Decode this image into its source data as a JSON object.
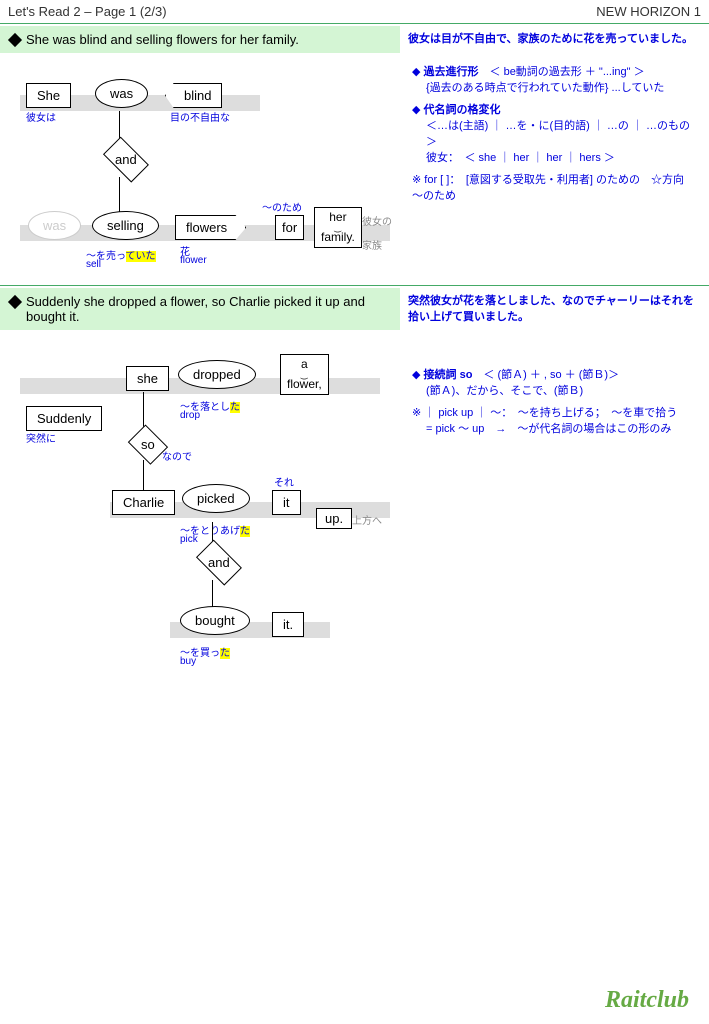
{
  "header": {
    "left": "Let's Read 2 – Page 1 (2/3)",
    "right": "NEW HORIZON 1"
  },
  "sec1": {
    "en": "She was blind and selling flowers for her family.",
    "jp": "彼女は目が不自由で、家族のために花を売っていました。",
    "w": {
      "she": "She",
      "was": "was",
      "blind": "blind",
      "and": "and",
      "was2": "was",
      "selling": "selling",
      "flowers": "flowers",
      "for": "for",
      "her": "her",
      "family": "family."
    },
    "a": {
      "she": "彼女は",
      "blind": "目の不自由な",
      "selling1": "～を売っ",
      "selling2": "ていた",
      "sell": "sell",
      "flowers": "花",
      "flower": "flower",
      "for_top": "～のため",
      "her": "彼女の",
      "family": "家族"
    },
    "notes": {
      "n1t": "過去進行形",
      "n1b": "＜ be動詞の過去形 ＋ \"...ing\" ＞",
      "n1s": "{過去のある時点で行われていた動作} ...していた",
      "n2t": "代名詞の格変化",
      "n2b": "＜…は(主語) ｜ …を・に(目的語) ｜ …の ｜ …のもの＞",
      "n2s": "彼女：　＜ she ｜ her ｜ her ｜ hers ＞",
      "n3": "※ for [  ]：　[意図する受取先・利用者] のための　☆方向 ～のため"
    }
  },
  "sec2": {
    "en": "Suddenly she dropped a flower, so Charlie picked it up and bought it.",
    "jp": "突然彼女が花を落としました、なのでチャーリーはそれを拾い上げて買いました。",
    "w": {
      "suddenly": "Suddenly",
      "she": "she",
      "dropped": "dropped",
      "a": "a",
      "flower": "flower,",
      "so": "so",
      "charlie": "Charlie",
      "picked": "picked",
      "it1": "it",
      "up": "up.",
      "and": "and",
      "bought": "bought",
      "it2": "it."
    },
    "a": {
      "suddenly": "突然に",
      "dropped1": "～を落とし",
      "dropped2": "た",
      "drop": "drop",
      "so": "なので",
      "picked1": "～をとりあげ",
      "picked2": "た",
      "pick": "pick",
      "it1": "それ",
      "up": "上方へ",
      "bought1": "～を買っ",
      "bought2": "た",
      "buy": "buy"
    },
    "notes": {
      "n1t": "接続詞 so",
      "n1b": "＜ (節Ａ) ＋ , so ＋ (節Ｂ)＞",
      "n1s": "(節Ａ)、だから、そこで、(節Ｂ)",
      "n2": "※ ｜ pick up ｜ ～：　～を持ち上げる；　～を車で拾う",
      "n2s": "= pick ～ up　→　～が代名詞の場合はこの形のみ"
    }
  },
  "footer": "Raitclub"
}
